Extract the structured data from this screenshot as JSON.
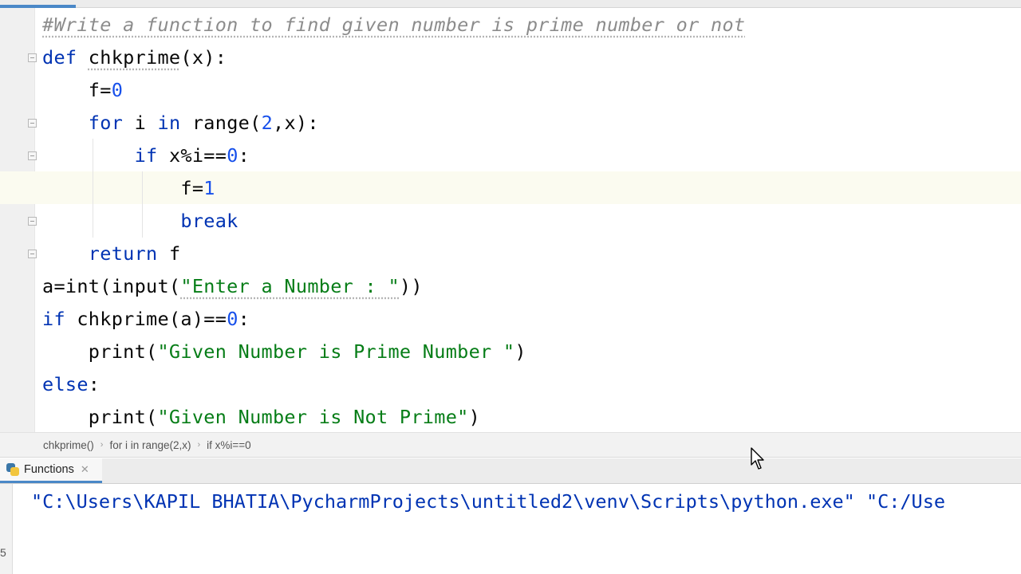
{
  "editor": {
    "lines": [
      [
        {
          "t": "#Write a function to find given number is prime number or not",
          "c": "comment squiggle"
        }
      ],
      [
        {
          "t": "def ",
          "c": "kw"
        },
        {
          "t": "chkprime",
          "c": "ident squiggle"
        },
        {
          "t": "(x):",
          "c": "ident"
        }
      ],
      [
        {
          "t": "    f=",
          "c": "ident"
        },
        {
          "t": "0",
          "c": "num"
        }
      ],
      [
        {
          "t": "    ",
          "c": "ident"
        },
        {
          "t": "for ",
          "c": "kw"
        },
        {
          "t": "i ",
          "c": "ident"
        },
        {
          "t": "in ",
          "c": "kw"
        },
        {
          "t": "range",
          "c": "ident"
        },
        {
          "t": "(",
          "c": "ident"
        },
        {
          "t": "2",
          "c": "num"
        },
        {
          "t": ",x):",
          "c": "ident"
        }
      ],
      [
        {
          "t": "        ",
          "c": "ident"
        },
        {
          "t": "if ",
          "c": "kw"
        },
        {
          "t": "x%i==",
          "c": "ident"
        },
        {
          "t": "0",
          "c": "num"
        },
        {
          "t": ":",
          "c": "ident"
        }
      ],
      [
        {
          "t": "            f=",
          "c": "ident"
        },
        {
          "t": "1",
          "c": "num"
        }
      ],
      [
        {
          "t": "            ",
          "c": "ident"
        },
        {
          "t": "break",
          "c": "kw"
        }
      ],
      [
        {
          "t": "    ",
          "c": "ident"
        },
        {
          "t": "return ",
          "c": "kw"
        },
        {
          "t": "f",
          "c": "ident"
        }
      ],
      [
        {
          "t": "a=int(input(",
          "c": "ident"
        },
        {
          "t": "\"Enter a Number : \"",
          "c": "str squiggle"
        },
        {
          "t": "))",
          "c": "ident"
        }
      ],
      [
        {
          "t": "if ",
          "c": "kw"
        },
        {
          "t": "chkprime(a)==",
          "c": "ident"
        },
        {
          "t": "0",
          "c": "num"
        },
        {
          "t": ":",
          "c": "ident"
        }
      ],
      [
        {
          "t": "    print(",
          "c": "ident"
        },
        {
          "t": "\"Given Number is Prime Number \"",
          "c": "str"
        },
        {
          "t": ")",
          "c": "ident"
        }
      ],
      [
        {
          "t": "else",
          "c": "kw"
        },
        {
          "t": ":",
          "c": "ident"
        }
      ],
      [
        {
          "t": "    print(",
          "c": "ident"
        },
        {
          "t": "\"Given Number is Not Prime\"",
          "c": "str"
        },
        {
          "t": ")",
          "c": "ident"
        }
      ]
    ]
  },
  "breadcrumb": {
    "items": [
      "chkprime()",
      "for i in range(2,x)",
      "if x%i==0"
    ],
    "separator": "›"
  },
  "run_panel": {
    "tab_label": "Functions",
    "close_glyph": "✕",
    "output": "\"C:\\Users\\KAPIL BHATIA\\PycharmProjects\\untitled2\\venv\\Scripts\\python.exe\" \"C:/Use"
  },
  "colors": {
    "keyword": "#0033b3",
    "number": "#1750eb",
    "string": "#067d17",
    "comment": "#8c8c8c",
    "accent": "#4a88c7"
  }
}
